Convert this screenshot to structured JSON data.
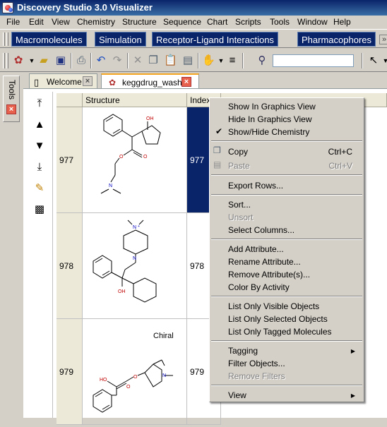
{
  "window": {
    "title": "Discovery Studio 3.0 Visualizer"
  },
  "menubar": [
    "File",
    "Edit",
    "View",
    "Chemistry",
    "Structure",
    "Sequence",
    "Chart",
    "Scripts",
    "Tools",
    "Window",
    "Help"
  ],
  "perspectives": [
    "Macromolecules",
    "Simulation",
    "Receptor-Ligand Interactions",
    "Pharmacophores"
  ],
  "tools_panel": {
    "label": "Tools"
  },
  "tabs": [
    {
      "label": "Welcome"
    },
    {
      "label": "keggdrug_wash"
    }
  ],
  "table": {
    "headers": [
      "Structure",
      "Index"
    ],
    "rows": [
      {
        "row": "977",
        "index": "977",
        "chiral": ""
      },
      {
        "row": "978",
        "index": "978",
        "chiral": ""
      },
      {
        "row": "979",
        "index": "979",
        "chiral": "Chiral"
      }
    ]
  },
  "context_menu": {
    "items": [
      {
        "label": "Show In Graphics View"
      },
      {
        "label": "Hide In Graphics View"
      },
      {
        "label": "Show/Hide Chemistry",
        "checked": true
      },
      {
        "label": "Copy",
        "shortcut": "Ctrl+C"
      },
      {
        "label": "Paste",
        "shortcut": "Ctrl+V",
        "disabled": true
      },
      {
        "label": "Export Rows..."
      },
      {
        "label": "Sort..."
      },
      {
        "label": "Unsort",
        "disabled": true
      },
      {
        "label": "Select Columns..."
      },
      {
        "label": "Add Attribute..."
      },
      {
        "label": "Rename Attribute..."
      },
      {
        "label": "Remove Attribute(s)..."
      },
      {
        "label": "Color By Activity"
      },
      {
        "label": "List Only Visible Objects"
      },
      {
        "label": "List Only Selected Objects"
      },
      {
        "label": "List Only Tagged Molecules"
      },
      {
        "label": "Tagging",
        "submenu": true
      },
      {
        "label": "Filter Objects..."
      },
      {
        "label": "Remove Filters",
        "disabled": true
      },
      {
        "label": "View",
        "submenu": true
      }
    ]
  },
  "colors": {
    "title_bar": "#0a246a",
    "selection": "#0a246a",
    "close_box": "#e8614d"
  }
}
